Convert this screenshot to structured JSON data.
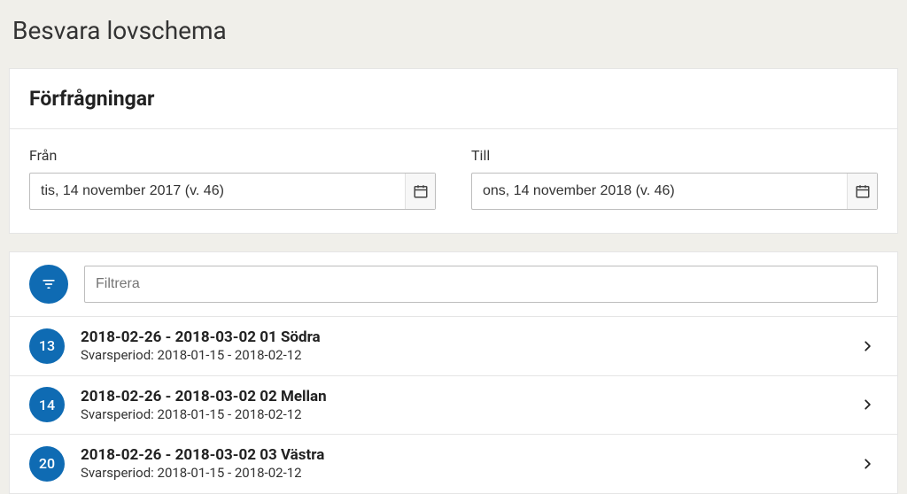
{
  "page": {
    "title": "Besvara lovschema"
  },
  "requests_panel": {
    "heading": "Förfrågningar",
    "from_label": "Från",
    "from_value": "tis, 14 november 2017 (v. 46)",
    "to_label": "Till",
    "to_value": "ons, 14 november 2018 (v. 46)"
  },
  "filter": {
    "placeholder": "Filtrera"
  },
  "items": [
    {
      "count": "13",
      "title": "2018-02-26 - 2018-03-02 01 Södra",
      "sub": "Svarsperiod: 2018-01-15 - 2018-02-12"
    },
    {
      "count": "14",
      "title": "2018-02-26 - 2018-03-02 02 Mellan",
      "sub": "Svarsperiod: 2018-01-15 - 2018-02-12"
    },
    {
      "count": "20",
      "title": "2018-02-26 - 2018-03-02 03 Västra",
      "sub": "Svarsperiod: 2018-01-15 - 2018-02-12"
    }
  ]
}
